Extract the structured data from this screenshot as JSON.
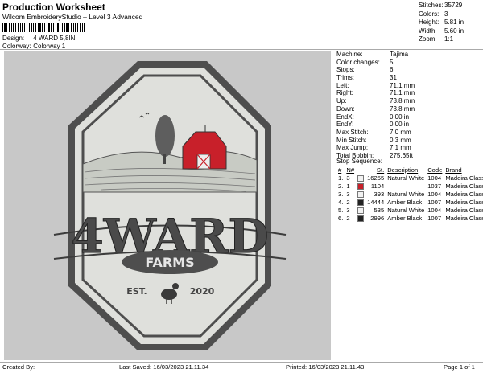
{
  "header": {
    "title": "Production Worksheet",
    "subtitle": "Wilcom EmbroideryStudio – Level 3 Advanced",
    "design_label": "Design:",
    "design_value": "4 WARD 5,8IN",
    "colorway_label": "Colorway:",
    "colorway_value": "Colorway 1"
  },
  "stats": [
    {
      "label": "Stitches:",
      "value": "35729"
    },
    {
      "label": "Colors:",
      "value": "3"
    },
    {
      "label": "Height:",
      "value": "5.81 in"
    },
    {
      "label": "Width:",
      "value": "5.60 in"
    },
    {
      "label": "Zoom:",
      "value": "1:1"
    }
  ],
  "properties": [
    {
      "label": "Machine:",
      "value": "Tajima"
    },
    {
      "label": "Color changes:",
      "value": "5"
    },
    {
      "label": "Stops:",
      "value": "6"
    },
    {
      "label": "Trims:",
      "value": "31"
    },
    {
      "label": "Left:",
      "value": "71.1 mm"
    },
    {
      "label": "Right:",
      "value": "71.1 mm"
    },
    {
      "label": "Up:",
      "value": "73.8 mm"
    },
    {
      "label": "Down:",
      "value": "73.8 mm"
    },
    {
      "label": "EndX:",
      "value": "0.00 in"
    },
    {
      "label": "EndY:",
      "value": "0.00 in"
    },
    {
      "label": "Max Stitch:",
      "value": "7.0 mm"
    },
    {
      "label": "Min Stitch:",
      "value": "0.3 mm"
    },
    {
      "label": "Max Jump:",
      "value": "7.1 mm"
    },
    {
      "label": "Total Bobbin:",
      "value": "275.65ft"
    }
  ],
  "sequence": {
    "heading": "Stop Sequence:",
    "columns": [
      "#",
      "N#",
      "",
      "St.",
      "Description",
      "Code",
      "Brand"
    ],
    "rows": [
      {
        "stop": "1.",
        "n": "3",
        "color": "#f2f2f2",
        "st": "16255",
        "desc": "Natural White",
        "code": "1004",
        "brand": "Madeira Classic 40"
      },
      {
        "stop": "2.",
        "n": "1",
        "color": "#c8202a",
        "st": "1104",
        "desc": "",
        "code": "1037",
        "brand": "Madeira Classic 40"
      },
      {
        "stop": "3.",
        "n": "3",
        "color": "#f2f2f2",
        "st": "393",
        "desc": "Natural White",
        "code": "1004",
        "brand": "Madeira Classic 40"
      },
      {
        "stop": "4.",
        "n": "2",
        "color": "#222222",
        "st": "14444",
        "desc": "Amber Black",
        "code": "1007",
        "brand": "Madeira Classic 40"
      },
      {
        "stop": "5.",
        "n": "3",
        "color": "#f2f2f2",
        "st": "535",
        "desc": "Natural White",
        "code": "1004",
        "brand": "Madeira Classic 40"
      },
      {
        "stop": "6.",
        "n": "2",
        "color": "#222222",
        "st": "2996",
        "desc": "Amber Black",
        "code": "1007",
        "brand": "Madeira Classic 40"
      }
    ]
  },
  "design_art": {
    "main_text": "4WARD",
    "banner_text": "FARMS",
    "est_text": "EST.",
    "year_text": "2020"
  },
  "footer": {
    "created_by": "Created By:",
    "last_saved": "Last Saved: 16/03/2023 21.11.34",
    "printed": "Printed: 16/03/2023 21.11.43",
    "page": "Page 1 of 1"
  }
}
